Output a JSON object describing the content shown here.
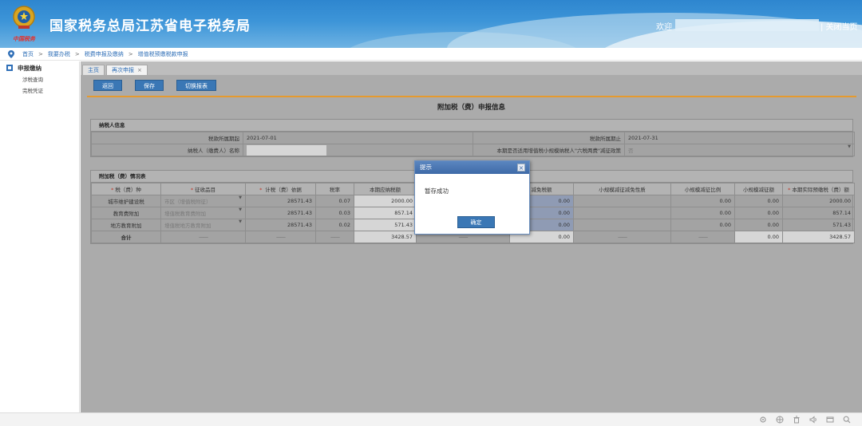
{
  "header": {
    "title": "国家税务总局江苏省电子税务局",
    "motto": "中国税务",
    "welcome": "欢迎",
    "close_page": "| 关闭当页"
  },
  "breadcrumb": [
    "首页",
    "我要办税",
    "税费申报及缴纳",
    "增值税预缴税款申报"
  ],
  "sidebar": {
    "group": "申报缴纳",
    "items": [
      "涉税查询",
      "完税凭证"
    ]
  },
  "tabs": [
    {
      "label": "主页"
    },
    {
      "label": "再次申报",
      "close": "×"
    }
  ],
  "toolbar": {
    "back": "返回",
    "save": "保存",
    "switch": "切换报表"
  },
  "form": {
    "title": "附加税（费）申报信息",
    "taxpayer_section": "纳税人信息",
    "period_start_label": "税款所属期起",
    "period_start": "2021-07-01",
    "period_end_label": "税款所属期止",
    "period_end": "2021-07-31",
    "taxpayer_name_label": "纳税人（缴费人）名称",
    "policy_label": "本期是否适用增值税小规模纳税人\"六税两费\"减征政策",
    "policy_value": "否",
    "detail_section": "附加税（费）情况表",
    "columns": [
      "*税（费）种",
      "*征收品目",
      "* 计税（费）依据",
      "税率",
      "本期应纳税额",
      "",
      "减免税额",
      "小规模减征减免性质",
      "小规模减征比例",
      "小规模减征额",
      "*本期实际预缴税（费）额"
    ],
    "rows": [
      {
        "type": "城市维护建设税",
        "item": "市区（增值税附征）",
        "base": "28571.43",
        "rate": "0.07",
        "payable": "2000.00",
        "exempt": "0.00",
        "small_ratio": "0.00",
        "small_amt": "0.00",
        "actual": "2000.00"
      },
      {
        "type": "教育费附加",
        "item": "增值税教育费附加",
        "base": "28571.43",
        "rate": "0.03",
        "payable": "857.14",
        "exempt": "0.00",
        "small_ratio": "0.00",
        "small_amt": "0.00",
        "actual": "857.14"
      },
      {
        "type": "地方教育附加",
        "item": "增值税地方教育附加",
        "base": "28571.43",
        "rate": "0.02",
        "payable": "571.43",
        "exempt": "0.00",
        "small_ratio": "0.00",
        "small_amt": "0.00",
        "actual": "571.43"
      }
    ],
    "total": {
      "label": "合计",
      "dash": "——",
      "payable": "3428.57",
      "exempt": "0.00",
      "small_amt": "0.00",
      "actual": "3428.57"
    }
  },
  "modal": {
    "title": "提示",
    "message": "暂存成功",
    "ok": "确定"
  }
}
